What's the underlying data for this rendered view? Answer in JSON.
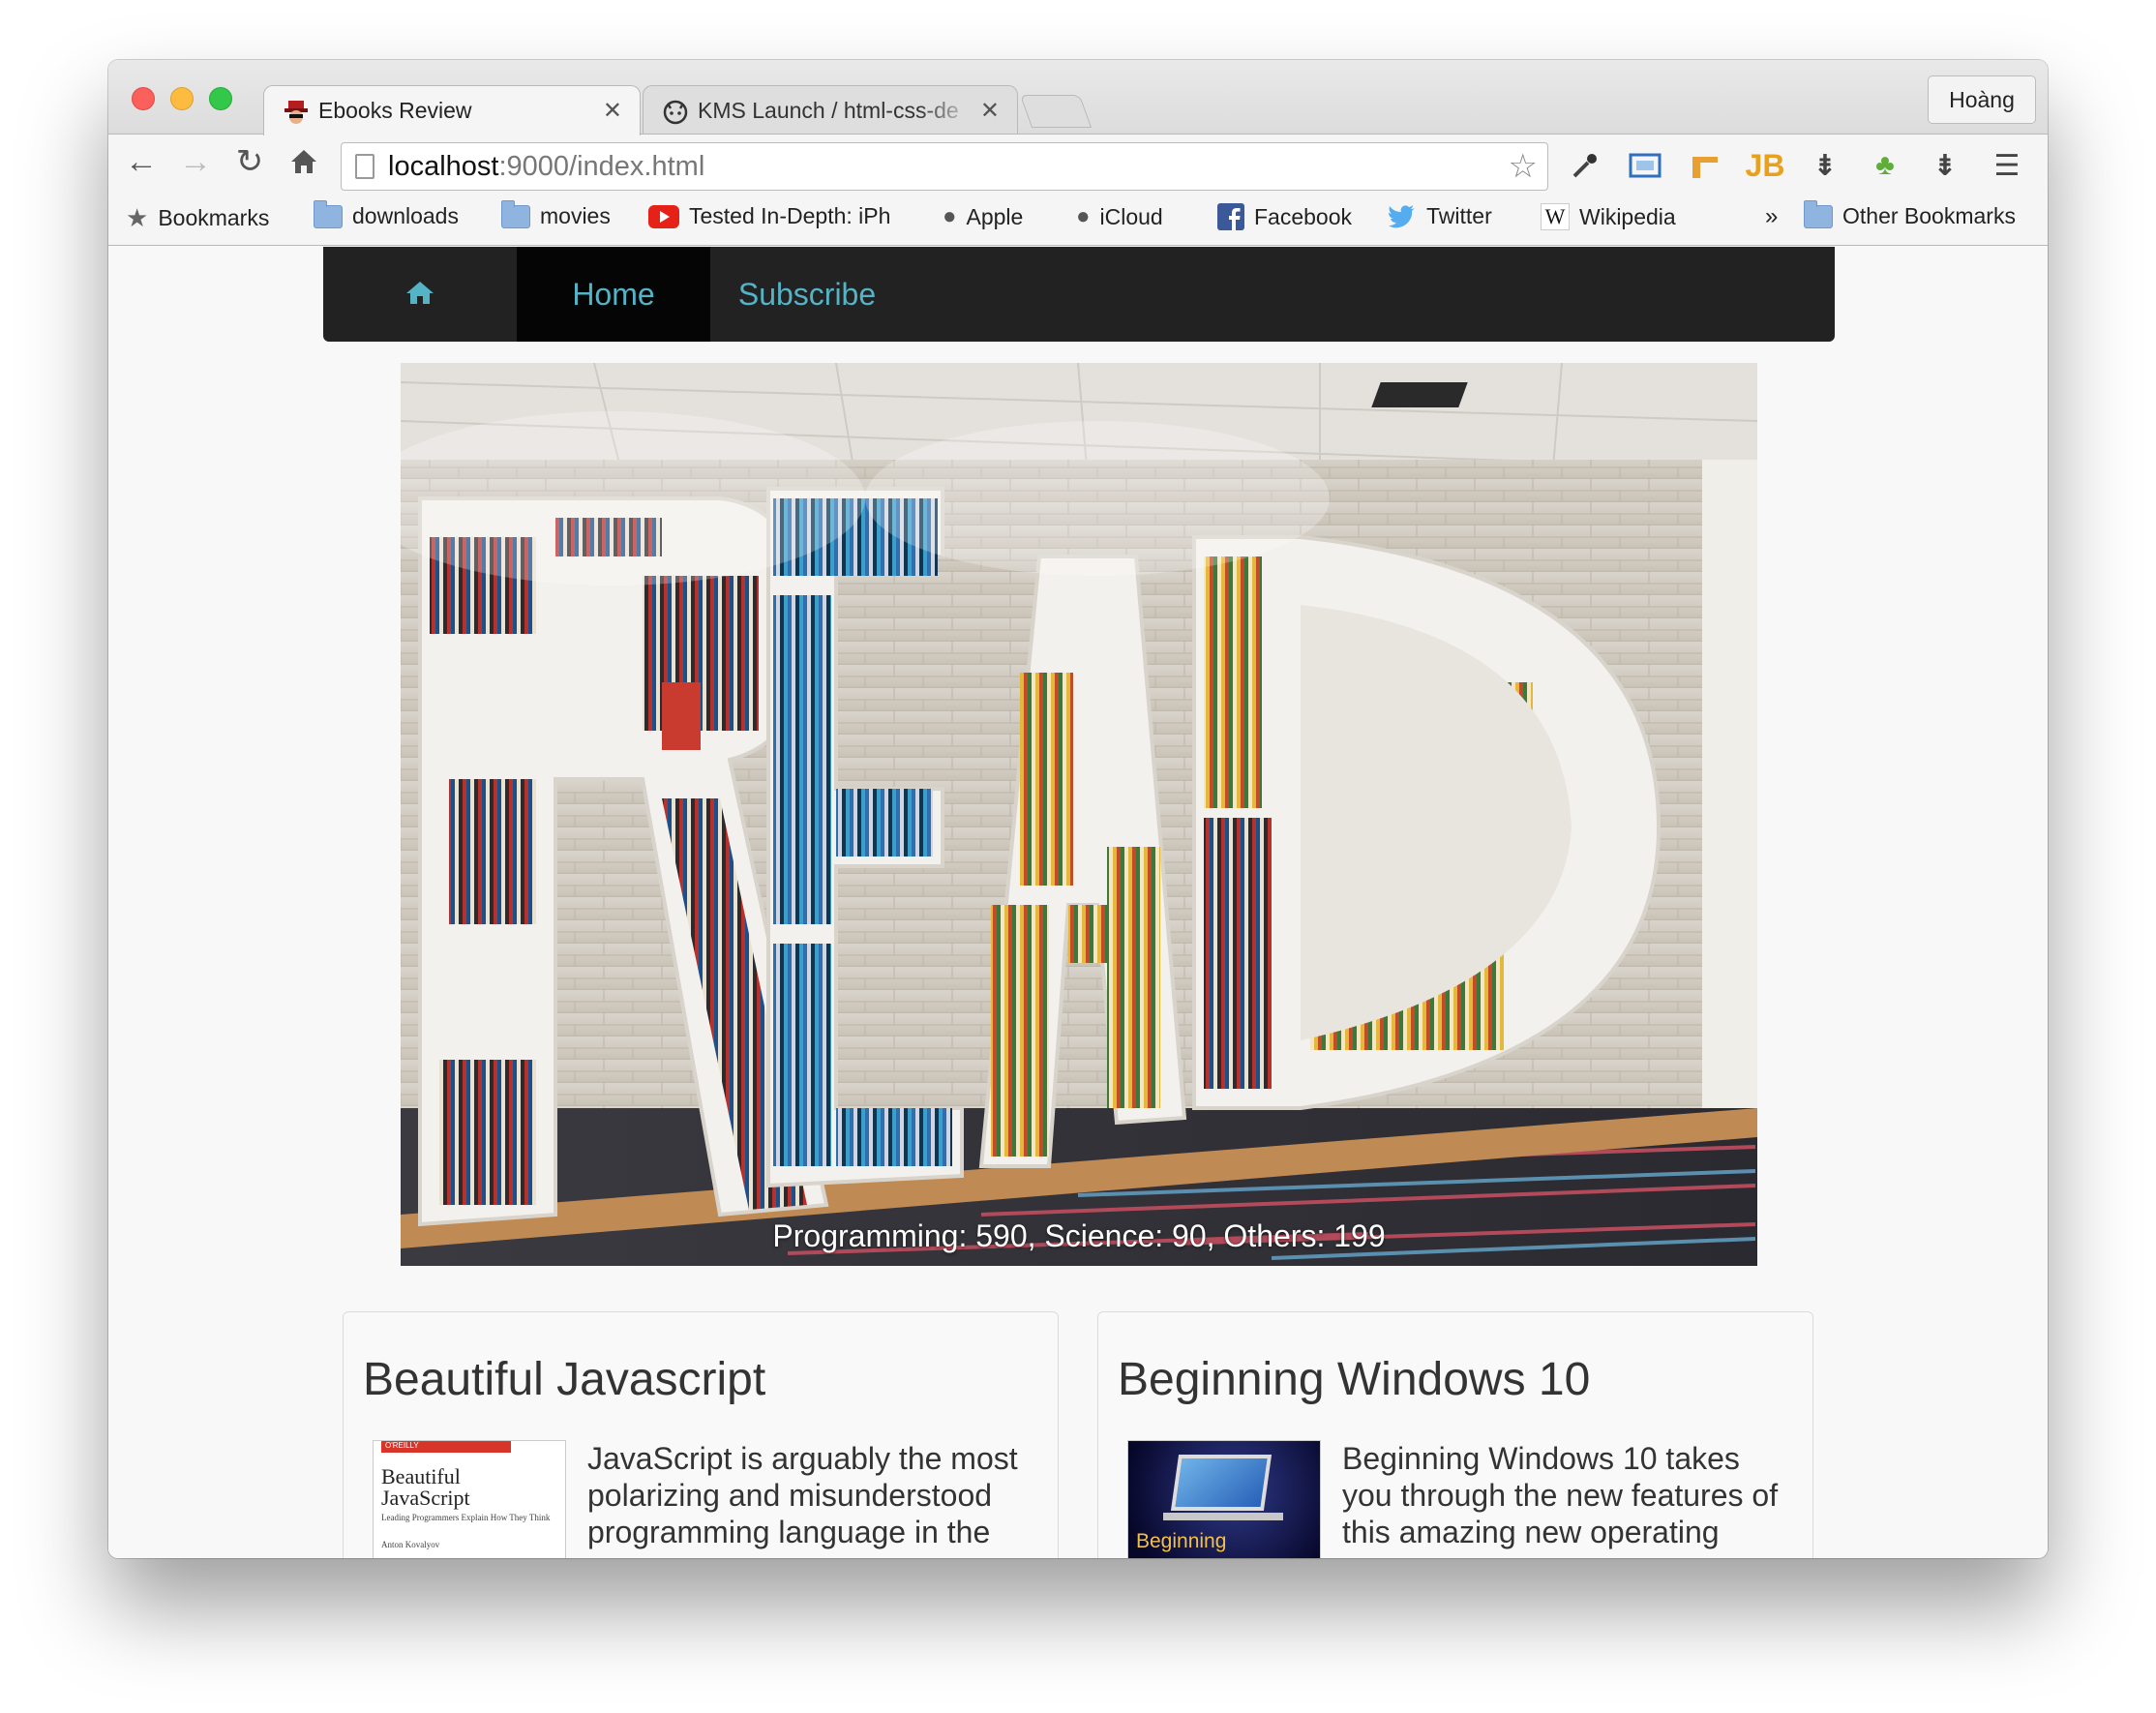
{
  "browser": {
    "tabs": [
      {
        "title": "Ebooks Review",
        "active": true,
        "icon": "spy-hat-icon"
      },
      {
        "title": "KMS Launch / html-css-de",
        "active": false,
        "icon": "github-octocat-icon"
      }
    ],
    "profile_name": "Hoàng",
    "url_host": "localhost",
    "url_rest": ":9000/index.html",
    "bookmarks": [
      {
        "label": "Bookmarks",
        "icon": "star-icon"
      },
      {
        "label": "downloads",
        "icon": "folder-icon"
      },
      {
        "label": "movies",
        "icon": "folder-icon"
      },
      {
        "label": "Tested In-Depth: iPh",
        "icon": "youtube-icon"
      },
      {
        "label": "Apple",
        "icon": "apple-icon"
      },
      {
        "label": "iCloud",
        "icon": "apple-icon"
      },
      {
        "label": "Facebook",
        "icon": "facebook-icon"
      },
      {
        "label": "Twitter",
        "icon": "twitter-icon"
      },
      {
        "label": "Wikipedia",
        "icon": "wikipedia-icon"
      }
    ],
    "overflow_label": "»",
    "other_bookmarks": "Other Bookmarks"
  },
  "site": {
    "nav": {
      "home_icon": "home-icon",
      "home": "Home",
      "subscribe": "Subscribe"
    },
    "hero": {
      "caption": "Programming: 590, Science: 90, Others: 199"
    },
    "cards": [
      {
        "title": "Beautiful Javascript",
        "text": "JavaScript is arguably the most polarizing and misunderstood programming language in the",
        "cover": {
          "publisher": "O'REILLY",
          "title_line1": "Beautiful",
          "title_line2": "JavaScript",
          "subtitle": "Leading Programmers Explain How They Think",
          "author": "Anton Kovalyov"
        }
      },
      {
        "title": "Beginning Windows 10",
        "text": "Beginning Windows 10 takes you through the new features of this amazing new operating",
        "cover": {
          "label": "Beginning"
        }
      }
    ]
  },
  "colors": {
    "nav_bg": "#222222",
    "nav_active_bg": "#050505",
    "nav_link": "#55b3c6"
  }
}
